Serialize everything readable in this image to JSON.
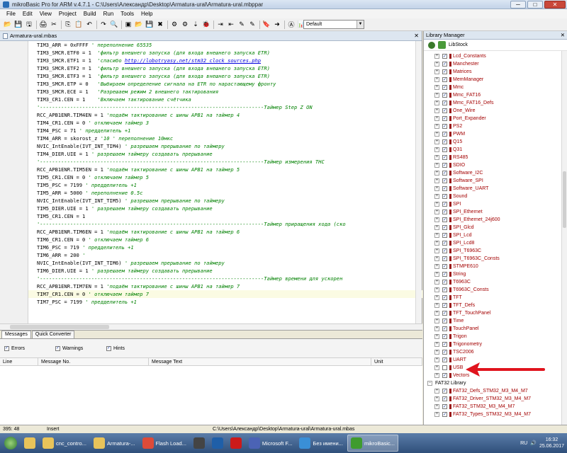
{
  "window": {
    "title": "mikroBasic Pro for ARM v.4.7.1 - C:\\Users\\Александр\\Desktop\\Armatura-ural\\Armatura-ural.mbppar",
    "min_glyph": "─",
    "max_glyph": "□",
    "close_glyph": "✕"
  },
  "menu": [
    "File",
    "Edit",
    "View",
    "Project",
    "Build",
    "Run",
    "Tools",
    "Help"
  ],
  "toolbar": {
    "config_value": "Default",
    "icons": [
      "folder-open-icon",
      "save-icon",
      "save-all-icon",
      "print-icon",
      "cut-icon",
      "copy-icon",
      "paste-icon",
      "undo-icon",
      "redo-icon",
      "find-icon",
      "project-icon",
      "open-project-icon",
      "save-project-icon",
      "close-project-icon",
      "build-icon",
      "build-all-icon",
      "program-icon",
      "debug-icon",
      "indent-icon",
      "outdent-icon",
      "comment-icon",
      "uncomment-icon",
      "bookmark-icon",
      "goto-icon",
      "ascii-icon",
      "statistics-icon",
      "help-icon"
    ],
    "glyphs": [
      "📂",
      "💾",
      "🖫",
      "🖨",
      "✂",
      "⎘",
      "📋",
      "↶",
      "↷",
      "🔍",
      "▣",
      "📂",
      "💾",
      "✖",
      "⚙",
      "⚙",
      "⇣",
      "🐞",
      "⇥",
      "⇤",
      "✎",
      "✎",
      "🔖",
      "➜",
      "Ⓐ",
      "📊",
      "?"
    ]
  },
  "editor": {
    "tab_title": "Armatura-ural.mbas",
    "close_glyph": "✕",
    "lines": [
      {
        "n": "",
        "code": "TIM3_ARR = 0xFFFF ",
        "comment": "' переполнение 65535"
      },
      {
        "n": "",
        "code": "TIM3_SMCR.ETF0 = 1  ",
        "comment": "'фильтр внешнего запуска (для входа внешнего запуска ETR)"
      },
      {
        "n": "",
        "code": "TIM3_SMCR.ETF1 = 1  ",
        "comment": "'спасибо ",
        "link": "http://lobotryasy.net/stm32_clock_sources.php"
      },
      {
        "n": "",
        "code": "TIM3_SMCR.ETF2 = 1  ",
        "comment": "'фильтр внешнего запуска (для входа внешнего запуска ETR)"
      },
      {
        "n": "",
        "code": "TIM3_SMCR.ETF3 = 1  ",
        "comment": "'фильтр внешнего запуска (для входа внешнего запуска ETR)"
      },
      {
        "n": "",
        "code": "TIM3_SMCR.ETP = 0   ",
        "comment": "'Выбираем определение сигнала на ETR по нарастающему фронту"
      },
      {
        "n": "",
        "code": "TIM3_SMCR.ECE = 1   ",
        "comment": "'Разрешаем режим 2 внешнего тактирования"
      },
      {
        "n": "370",
        "code": "TIM3_CR1.CEN = 1    ",
        "comment": "'Включаем тактирование счётчика"
      },
      {
        "n": "",
        "code": "",
        "comment": "'--------------------------------------------------------------------------Таймер Step Z ON"
      },
      {
        "n": "",
        "code": "RCC_APB1ENR.TIM4EN = 1 ",
        "comment": "'подаём тактирование с шины APB1 на таймер 4"
      },
      {
        "n": "",
        "code": "TIM4_CR1.CEN = 0 ",
        "comment": "' отключаем таймер 3"
      },
      {
        "n": "",
        "code": "TIM4_PSC = 71 ",
        "comment": "' предделитель +1"
      },
      {
        "n": "",
        "code": "TIM4_ARR = skorost_z ",
        "comment": "'10 ' переполнение 10мкс"
      },
      {
        "n": "",
        "code": "NVIC_IntEnable(IVT_INT_TIM4) ",
        "comment": "' разрешаем прерывание по таймеру"
      },
      {
        "n": "",
        "code": "TIM4_DIER.UIE = 1 ",
        "comment": "' разрешаем таймеру создавать прерывание"
      },
      {
        "n": "",
        "code": "",
        "comment": "'--------------------------------------------------------------------------Таймер измерения THC"
      },
      {
        "n": "",
        "code": "RCC_APB1ENR.TIM5EN = 1 ",
        "comment": "'подаём тактирование с шины APB1 на таймер 5"
      },
      {
        "n": "380",
        "code": "TIM5_CR1.CEN = 0 ",
        "comment": "' отключаем таймер 5"
      },
      {
        "n": "",
        "code": "TIM5_PSC = 7199 ",
        "comment": "' предделитель +1"
      },
      {
        "n": "",
        "code": "TIM5_ARR = 5000 ",
        "comment": "' переполнение 0.5с"
      },
      {
        "n": "",
        "code": "NVIC_IntEnable(IVT_INT_TIM5) ",
        "comment": "' разрешаем прерывание по таймеру"
      },
      {
        "n": "",
        "code": "TIM5_DIER.UIE = 1 ",
        "comment": "' разрешаем таймеру создавать прерывание"
      },
      {
        "n": "",
        "code": "TIM5_CR1.CEN = 1",
        "comment": ""
      },
      {
        "n": "",
        "code": "",
        "comment": "'--------------------------------------------------------------------------Таймер приращения хода (ско"
      },
      {
        "n": "",
        "code": "RCC_APB1ENR.TIM6EN = 1 ",
        "comment": "'подаём тактирование с шины APB1 на таймер 6"
      },
      {
        "n": "",
        "code": "TIM6_CR1.CEN = 0 ",
        "comment": "' отключаем таймер 6"
      },
      {
        "n": "",
        "code": "TIM6_PSC = 719 ",
        "comment": "' предделитель +1"
      },
      {
        "n": "390",
        "code": "TIM6_ARR = 200 ",
        "comment": "'"
      },
      {
        "n": "",
        "code": "NVIC_IntEnable(IVT_INT_TIM6) ",
        "comment": "' разрешаем прерывание по таймеру"
      },
      {
        "n": "",
        "code": "TIM6_DIER.UIE = 1 ",
        "comment": "' разрешаем таймеру создавать прерывание"
      },
      {
        "n": "",
        "code": "",
        "comment": "'--------------------------------------------------------------------------Таймер времени для ускорен"
      },
      {
        "n": "",
        "code": "RCC_APB1ENR.TIM7EN = 1 ",
        "comment": "'подаём тактирование с шины APB1 на таймер 7"
      },
      {
        "n": "395",
        "code": "TIM7_CR1.CEN = 0 ",
        "comment": "' отключаем таймер 7"
      },
      {
        "n": "",
        "code": "TIM7_PSC = 7199 ",
        "comment": "' предделитель +1"
      }
    ]
  },
  "messages": {
    "tabs": [
      "Messages",
      "Quick Converter"
    ],
    "filters": [
      "Errors",
      "Warnings",
      "Hints"
    ],
    "check_glyph": "✓",
    "columns": [
      "Line",
      "Message No.",
      "Message Text",
      "Unit"
    ]
  },
  "status": {
    "position": "395: 48",
    "mode": "Insert",
    "path": "C:\\Users\\Александр\\Desktop\\Armatura-ural\\Armatura-ural.mbas"
  },
  "library": {
    "title": "Library Manager",
    "close_glyph": "✕",
    "libstock_label": "LibStock",
    "expand_glyph": "+",
    "collapse_glyph": "−",
    "items": [
      "Lcd_Constants",
      "Manchester",
      "Matrices",
      "MemManager",
      "Mmc",
      "Mmc_FAT16",
      "Mmc_FAT16_Defs",
      "One_Wire",
      "Port_Expander",
      "PS2",
      "PWM",
      "Q15",
      "Q31",
      "RS485",
      "SDIO",
      "Software_I2C",
      "Software_SPI",
      "Software_UART",
      "Sound",
      "SPI",
      "SPI_Ethernet",
      "SPI_Ethernet_24j600",
      "SPI_Glcd",
      "SPI_Lcd",
      "SPI_Lcd8",
      "SPI_T6963C",
      "SPI_T6963C_Consts",
      "STMPE610",
      "String",
      "T6963C",
      "T6963C_Consts",
      "TFT",
      "TFT_Defs",
      "TFT_TouchPanel",
      "Time",
      "TouchPanel",
      "Trigon",
      "Trigonometry",
      "TSC2006",
      "UART",
      "USB",
      "Vectors"
    ],
    "unchecked_item": "USB",
    "group": "FAT32 Library",
    "group_items": [
      "FAT32_Defs_STM32_M3_M4_M7",
      "FAT32_Driver_STM32_M3_M4_M7",
      "FAT32_STM32_M3_M4_M7",
      "FAT32_Types_STM32_M3_M4_M7"
    ]
  },
  "taskbar": {
    "items": [
      {
        "label": "",
        "icon": "explorer-icon",
        "color": "#e8c35a"
      },
      {
        "label": "cnc_contro...",
        "icon": "folder-icon",
        "color": "#e8c35a"
      },
      {
        "label": "Armatura-...",
        "icon": "folder-icon",
        "color": "#e8c35a"
      },
      {
        "label": "Flash Load...",
        "icon": "chrome-icon",
        "color": "#dd4b39"
      },
      {
        "label": "",
        "icon": "chip-icon",
        "color": "#444444"
      },
      {
        "label": "",
        "icon": "photoshop-icon",
        "color": "#1f5fa8"
      },
      {
        "label": "",
        "icon": "opera-icon",
        "color": "#cc1a1a"
      },
      {
        "label": "Microsoft F...",
        "icon": "visio-icon",
        "color": "#4b63b5"
      },
      {
        "label": "Без имени...",
        "icon": "paint-icon",
        "color": "#3a8fd6"
      },
      {
        "label": "mikroBasic...",
        "icon": "mikrobasic-icon",
        "color": "#3f9b2f"
      }
    ],
    "lang": "RU",
    "time": "16:32",
    "date": "25.06.2017"
  }
}
